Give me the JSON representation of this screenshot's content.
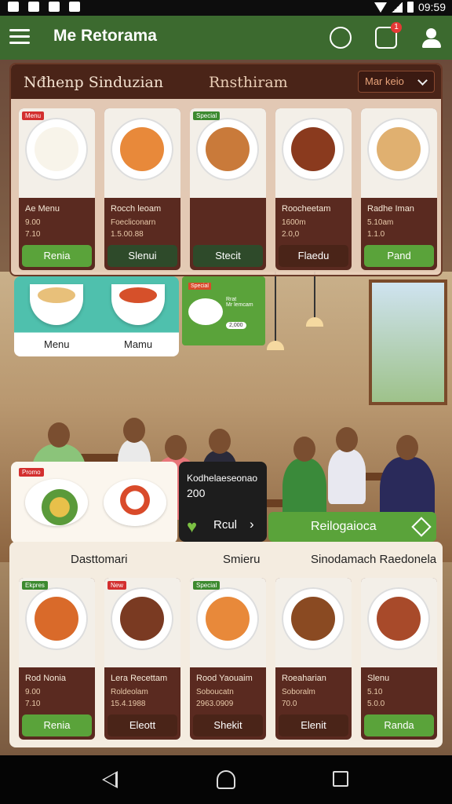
{
  "statusbar": {
    "time": "09:59"
  },
  "appbar": {
    "title": "Me Retorama",
    "notification_badge": "1",
    "icons": [
      "menu-icon",
      "chat-icon",
      "notification-icon",
      "user-icon"
    ]
  },
  "top_panel": {
    "brand": "Nđhenp Sinduzian",
    "subtitle": "Rnsthiram",
    "selector": "Mar keio",
    "cards": [
      {
        "tag": "Menu",
        "name": "Ae Menu",
        "line2": "9.00",
        "line3": "7.10",
        "button": "Renia",
        "tag_color": "#d32f2f",
        "food_color": "#f8f4ea",
        "button_color": "#5aa33a"
      },
      {
        "tag": "",
        "name": "Rocch leoam",
        "line2": "Foecliconarn",
        "line3": "1.5.00.88",
        "button": "Slenui",
        "tag_color": "",
        "food_color": "#e8893a",
        "button_color": "#2e4a2a"
      },
      {
        "tag": "Special",
        "name": "",
        "line2": "",
        "line3": "",
        "button": "Stecit",
        "tag_color": "#3c8a2f",
        "food_color": "#c97a3a",
        "button_color": "#2e4a2a"
      },
      {
        "tag": "",
        "name": "Roocheetam",
        "line2": "1600m",
        "line3": "2.0,0",
        "button": "Flaedu",
        "tag_color": "",
        "food_color": "#8a3a1e",
        "button_color": "#4a2418"
      },
      {
        "tag": "",
        "name": "Radhe Iman",
        "line2": "5.10am",
        "line3": "1.1.0",
        "button": "Pand",
        "tag_color": "",
        "food_color": "#e0b070",
        "button_color": "#5aa33a"
      }
    ]
  },
  "mid_left": {
    "labels": [
      "Menu",
      "Mamu"
    ]
  },
  "mid_right": {
    "tag": "Special",
    "lines": "Rrat\nMr lemcam",
    "pill": "2,000"
  },
  "promo": {
    "tag": "Promo",
    "mid_title": "Kodhelaeseonao",
    "mid_value": "200",
    "mid_link": "Rcul",
    "button": "Reilogaioca"
  },
  "bottom_panel": {
    "titles": [
      "Dasttomari",
      "Smieru",
      "Sinodamach Raedonela"
    ],
    "cards": [
      {
        "tag": "Ekpres",
        "name": "Rod Nonia",
        "line2": "9.00",
        "line3": "7.10",
        "button": "Renia",
        "tag_color": "#3c8a2f",
        "food_color": "#d96a2a",
        "button_color": "#5aa33a"
      },
      {
        "tag": "New",
        "name": "Lera Recettam",
        "line2": "Roldeolam",
        "line3": "15.4.1988",
        "button": "Eleott",
        "tag_color": "#d32f2f",
        "food_color": "#7a3a22",
        "button_color": "#4a2418"
      },
      {
        "tag": "Special",
        "name": "Rood Yaouaim",
        "line2": "Soboucatn",
        "line3": "2963.0909",
        "button": "Shekit",
        "tag_color": "#3c8a2f",
        "food_color": "#e8893a",
        "button_color": "#4a2418"
      },
      {
        "tag": "",
        "name": "Roeaharian",
        "line2": "Soboralm",
        "line3": "70.0",
        "button": "Elenit",
        "tag_color": "",
        "food_color": "#8a4a22",
        "button_color": "#4a2418"
      },
      {
        "tag": "",
        "name": "Slenu",
        "line2": "5.10",
        "line3": "5.0.0",
        "button": "Randa",
        "tag_color": "",
        "food_color": "#a84a2a",
        "button_color": "#5aa33a"
      }
    ]
  }
}
